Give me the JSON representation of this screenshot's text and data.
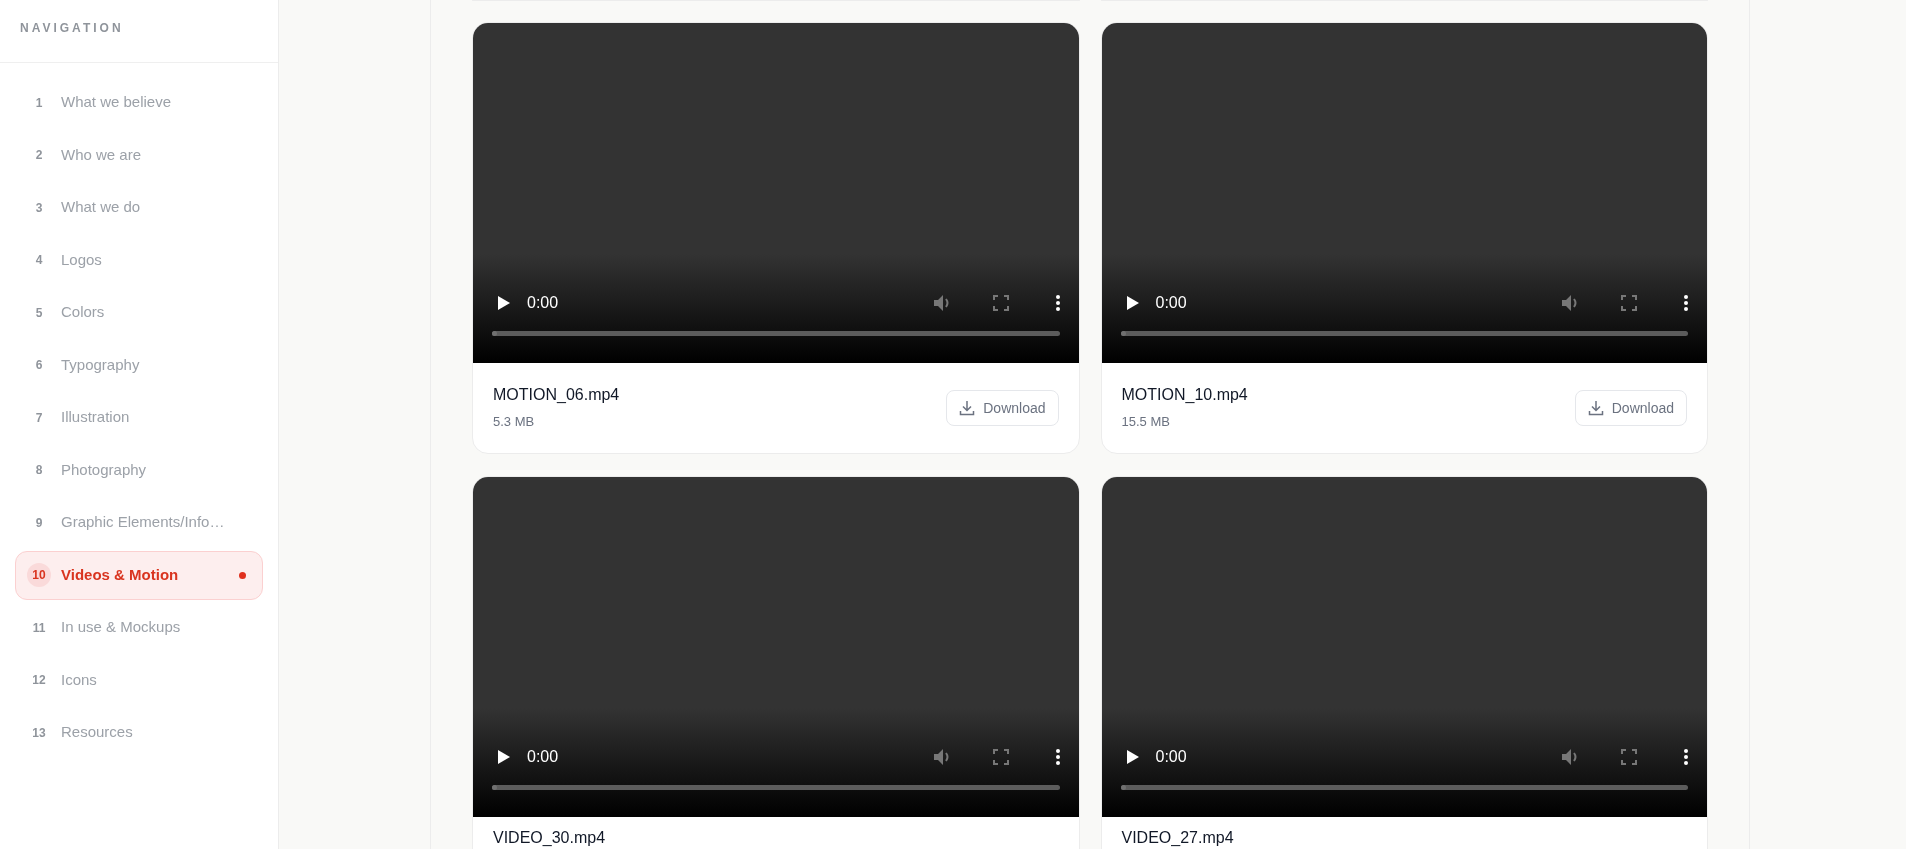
{
  "sidebar": {
    "heading": "NAVIGATION",
    "items": [
      {
        "number": "1",
        "label": "What we believe",
        "selected": false
      },
      {
        "number": "2",
        "label": "Who we are",
        "selected": false
      },
      {
        "number": "3",
        "label": "What we do",
        "selected": false
      },
      {
        "number": "4",
        "label": "Logos",
        "selected": false
      },
      {
        "number": "5",
        "label": "Colors",
        "selected": false
      },
      {
        "number": "6",
        "label": "Typography",
        "selected": false
      },
      {
        "number": "7",
        "label": "Illustration",
        "selected": false
      },
      {
        "number": "8",
        "label": "Photography",
        "selected": false
      },
      {
        "number": "9",
        "label": "Graphic Elements/Info…",
        "selected": false
      },
      {
        "number": "10",
        "label": "Videos & Motion",
        "selected": true
      },
      {
        "number": "11",
        "label": "In use & Mockups",
        "selected": false
      },
      {
        "number": "12",
        "label": "Icons",
        "selected": false
      },
      {
        "number": "13",
        "label": "Resources",
        "selected": false
      }
    ]
  },
  "videos": [
    {
      "time": "0:00",
      "level": 0,
      "name": "MOTION_06.mp4",
      "size": "5.3 MB",
      "button": "Download"
    },
    {
      "time": "0:00",
      "level": 0,
      "name": "MOTION_10.mp4",
      "size": "15.5 MB",
      "button": "Download"
    },
    {
      "time": "0:00",
      "level": 0,
      "name": "VIDEO_30.mp4"
    },
    {
      "time": "0:00",
      "level": 0,
      "name": "VIDEO_27.mp4"
    }
  ]
}
